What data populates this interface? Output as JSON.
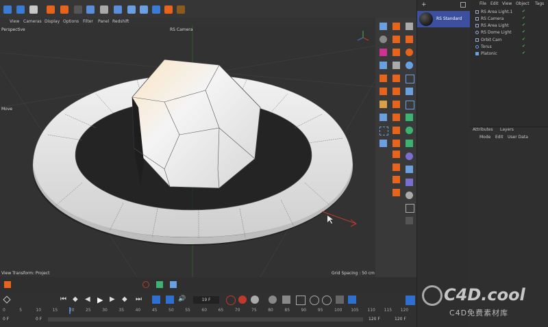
{
  "viewport": {
    "menu": [
      "View",
      "Cameras",
      "Display",
      "Options",
      "Filter",
      "Panel",
      "Redshift"
    ],
    "label": "Perspective",
    "camera": "RS Camera",
    "tool": "Move",
    "view_transform": "View Transform: Project",
    "grid_spacing": "Grid Spacing : 50 cm"
  },
  "material": {
    "name": "RS Standard"
  },
  "object_manager": {
    "menu": [
      "File",
      "Edit",
      "View",
      "Object",
      "Tags"
    ],
    "objects": [
      "RS Area Light.1",
      "RS Camera",
      "RS Area Light",
      "RS Dome Light",
      "Orbit Cam",
      "Torus",
      "Platonic"
    ]
  },
  "attributes": {
    "tabs": [
      "Attributes",
      "Layers"
    ],
    "menu": [
      "Mode",
      "Edit",
      "User Data"
    ]
  },
  "timeline": {
    "current_frame": "19 F",
    "start": "0 F",
    "offset": "0 F",
    "end": "120 F",
    "end2": "120 F",
    "ruler": [
      "0",
      "5",
      "10",
      "15",
      "20",
      "25",
      "30",
      "35",
      "40",
      "45",
      "50",
      "55",
      "60",
      "65",
      "70",
      "75",
      "80",
      "85",
      "90",
      "95",
      "100",
      "105",
      "110",
      "115",
      "120"
    ]
  },
  "watermark": {
    "main": "C4D.cool",
    "sub": "C4D免费素材库"
  },
  "colors": {
    "accent_orange": "#e8631c",
    "accent_blue": "#2f6fd0",
    "selected_mat": "#3d50a0"
  }
}
